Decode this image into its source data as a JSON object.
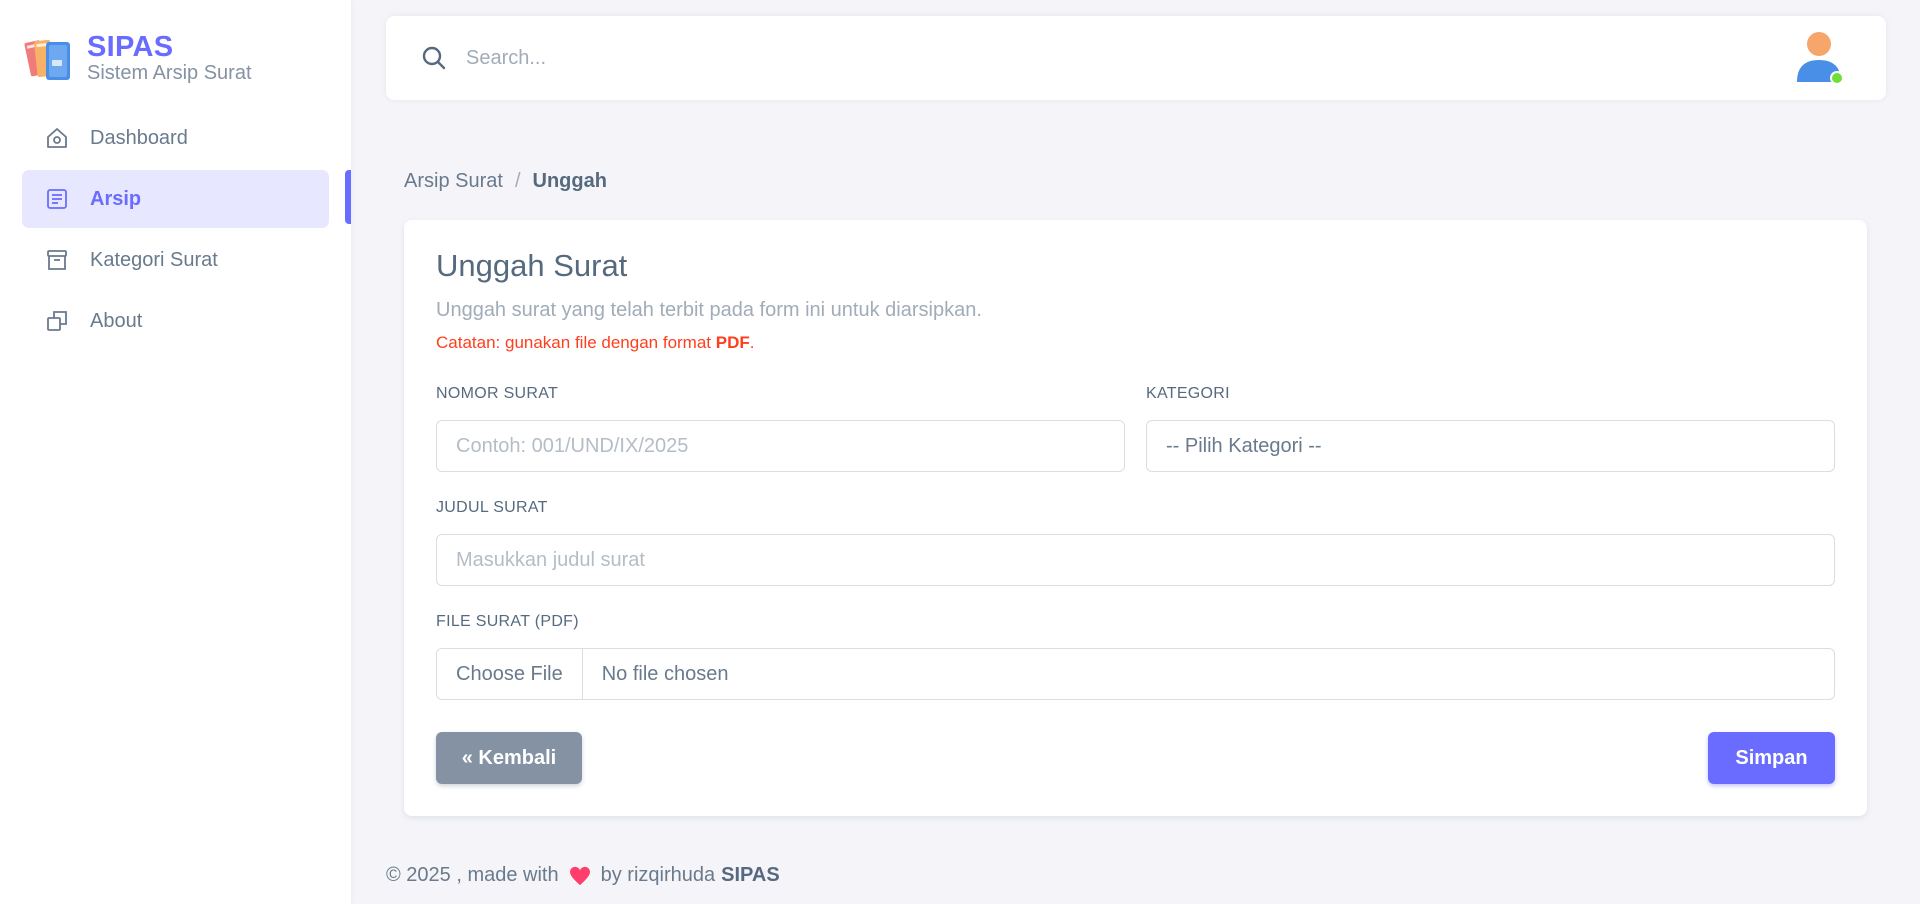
{
  "brand": {
    "name": "SIPAS",
    "subtitle": "Sistem Arsip Surat",
    "logo_icon": "books-logo-icon"
  },
  "sidebar": {
    "items": [
      {
        "label": "Dashboard",
        "icon": "home-icon",
        "active": false
      },
      {
        "label": "Arsip",
        "icon": "document-list-icon",
        "active": true
      },
      {
        "label": "Kategori Surat",
        "icon": "archive-box-icon",
        "active": false
      },
      {
        "label": "About",
        "icon": "copy-icon",
        "active": false
      }
    ]
  },
  "navbar": {
    "search_placeholder": "Search...",
    "avatar_status": "online"
  },
  "breadcrumb": {
    "parent": "Arsip Surat",
    "separator": "/",
    "current": "Unggah"
  },
  "form": {
    "title": "Unggah Surat",
    "subtitle": "Unggah surat yang telah terbit pada form ini untuk diarsipkan.",
    "note_prefix": "Catatan: gunakan file dengan format ",
    "note_format": "PDF",
    "note_suffix": ".",
    "nomor_label": "NOMOR SURAT",
    "nomor_placeholder": "Contoh: 001/UND/IX/2025",
    "kategori_label": "KATEGORI",
    "kategori_selected": "-- Pilih Kategori --",
    "judul_label": "JUDUL SURAT",
    "judul_placeholder": "Masukkan judul surat",
    "file_label": "FILE SURAT (PDF)",
    "file_button": "Choose File",
    "file_status": "No file chosen",
    "back_button": "« Kembali",
    "save_button": "Simpan"
  },
  "footer": {
    "prefix": "© 2025 , made with",
    "by": "by rizqirhuda",
    "brand": "SIPAS"
  },
  "colors": {
    "primary": "#696cff",
    "secondary": "#8592a3",
    "danger": "#ff3e1d",
    "background": "#f5f5f9"
  }
}
